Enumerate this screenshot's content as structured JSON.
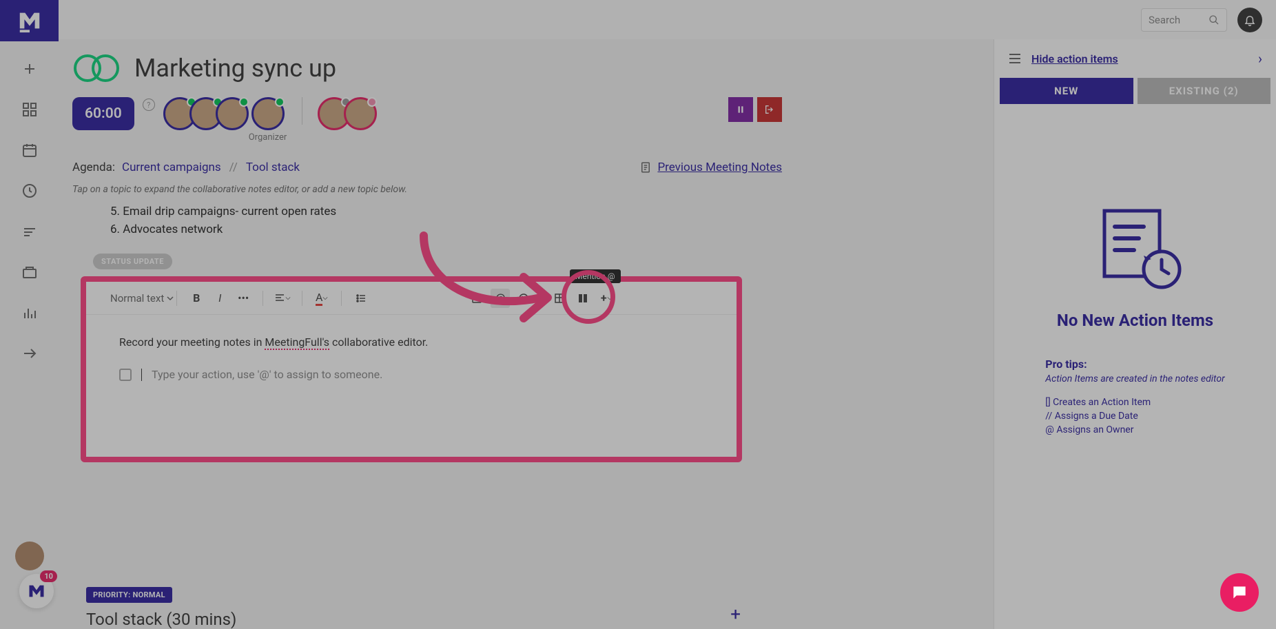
{
  "topbar": {
    "search_placeholder": "Search"
  },
  "page": {
    "title": "Marketing sync up",
    "timer": "60:00",
    "organizer_label": "Organizer",
    "agenda_label": "Agenda:",
    "agenda_item1": "Current campaigns",
    "agenda_sep": "//",
    "agenda_item2": "Tool stack",
    "prev_notes": "Previous Meeting Notes",
    "hint": "Tap on a topic to expand the collaborative notes editor, or add a new topic below.",
    "topic5": "5. Email drip campaigns- current open rates",
    "topic6": "6. Advocates network",
    "status_tag": "STATUS UPDATE",
    "priority_badge": "PRIORITY: NORMAL",
    "tool_stack_title": "Tool stack (30 mins)"
  },
  "editor": {
    "text_select": "Normal text",
    "content_prefix": "Record your meeting notes in ",
    "content_underlined": "MeetingFull's",
    "content_suffix": " collaborative editor.",
    "action_placeholder": "Type your action, use '@' to assign to someone.",
    "mention_tooltip": "Mention @"
  },
  "side": {
    "hide_link": "Hide action items",
    "tab_new": "NEW",
    "tab_existing": "EXISTING (2)",
    "empty_title": "No New Action Items",
    "tips_title": "Pro tips:",
    "tips_sub": "Action Items are created in the notes editor",
    "tip1": "[] Creates an Action Item",
    "tip2": "// Assigns a Due Date",
    "tip3": "@ Assigns an Owner"
  },
  "badge_count": "10"
}
